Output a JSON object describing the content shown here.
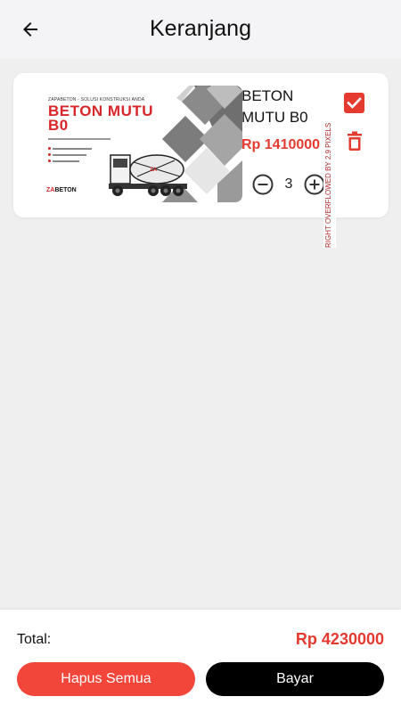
{
  "appbar": {
    "title": "Keranjang",
    "back_icon": "arrow-left-icon"
  },
  "cart": {
    "items": [
      {
        "name": "BETON MUTU B0",
        "price": "Rp 1410000",
        "quantity": "3",
        "checked": true,
        "image": {
          "top_text": "ZAPABETON - SOLUSI KONSTRUKSI ANDA",
          "heading": "BETON MUTU B0",
          "brand_prefix": "ZA",
          "brand_name": "BETON"
        }
      }
    ]
  },
  "debug_overlay": {
    "text": "RIGHT OVERFLOWED BY 2.9 PIXELS"
  },
  "summary": {
    "total_label": "Total:",
    "total_value": "Rp 4230000"
  },
  "actions": {
    "clear_label": "Hapus Semua",
    "pay_label": "Bayar"
  },
  "colors": {
    "accent": "#e53a30",
    "clear_button": "#f2463a",
    "pay_button": "#000000",
    "background": "#efefef"
  }
}
